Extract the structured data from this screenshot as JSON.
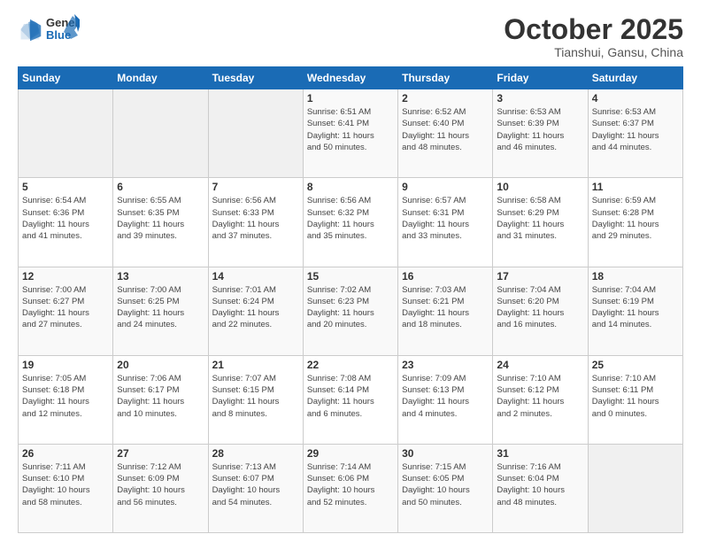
{
  "header": {
    "logo_line1": "General",
    "logo_line2": "Blue",
    "month": "October 2025",
    "location": "Tianshui, Gansu, China"
  },
  "days_of_week": [
    "Sunday",
    "Monday",
    "Tuesday",
    "Wednesday",
    "Thursday",
    "Friday",
    "Saturday"
  ],
  "weeks": [
    [
      {
        "day": "",
        "info": ""
      },
      {
        "day": "",
        "info": ""
      },
      {
        "day": "",
        "info": ""
      },
      {
        "day": "1",
        "info": "Sunrise: 6:51 AM\nSunset: 6:41 PM\nDaylight: 11 hours\nand 50 minutes."
      },
      {
        "day": "2",
        "info": "Sunrise: 6:52 AM\nSunset: 6:40 PM\nDaylight: 11 hours\nand 48 minutes."
      },
      {
        "day": "3",
        "info": "Sunrise: 6:53 AM\nSunset: 6:39 PM\nDaylight: 11 hours\nand 46 minutes."
      },
      {
        "day": "4",
        "info": "Sunrise: 6:53 AM\nSunset: 6:37 PM\nDaylight: 11 hours\nand 44 minutes."
      }
    ],
    [
      {
        "day": "5",
        "info": "Sunrise: 6:54 AM\nSunset: 6:36 PM\nDaylight: 11 hours\nand 41 minutes."
      },
      {
        "day": "6",
        "info": "Sunrise: 6:55 AM\nSunset: 6:35 PM\nDaylight: 11 hours\nand 39 minutes."
      },
      {
        "day": "7",
        "info": "Sunrise: 6:56 AM\nSunset: 6:33 PM\nDaylight: 11 hours\nand 37 minutes."
      },
      {
        "day": "8",
        "info": "Sunrise: 6:56 AM\nSunset: 6:32 PM\nDaylight: 11 hours\nand 35 minutes."
      },
      {
        "day": "9",
        "info": "Sunrise: 6:57 AM\nSunset: 6:31 PM\nDaylight: 11 hours\nand 33 minutes."
      },
      {
        "day": "10",
        "info": "Sunrise: 6:58 AM\nSunset: 6:29 PM\nDaylight: 11 hours\nand 31 minutes."
      },
      {
        "day": "11",
        "info": "Sunrise: 6:59 AM\nSunset: 6:28 PM\nDaylight: 11 hours\nand 29 minutes."
      }
    ],
    [
      {
        "day": "12",
        "info": "Sunrise: 7:00 AM\nSunset: 6:27 PM\nDaylight: 11 hours\nand 27 minutes."
      },
      {
        "day": "13",
        "info": "Sunrise: 7:00 AM\nSunset: 6:25 PM\nDaylight: 11 hours\nand 24 minutes."
      },
      {
        "day": "14",
        "info": "Sunrise: 7:01 AM\nSunset: 6:24 PM\nDaylight: 11 hours\nand 22 minutes."
      },
      {
        "day": "15",
        "info": "Sunrise: 7:02 AM\nSunset: 6:23 PM\nDaylight: 11 hours\nand 20 minutes."
      },
      {
        "day": "16",
        "info": "Sunrise: 7:03 AM\nSunset: 6:21 PM\nDaylight: 11 hours\nand 18 minutes."
      },
      {
        "day": "17",
        "info": "Sunrise: 7:04 AM\nSunset: 6:20 PM\nDaylight: 11 hours\nand 16 minutes."
      },
      {
        "day": "18",
        "info": "Sunrise: 7:04 AM\nSunset: 6:19 PM\nDaylight: 11 hours\nand 14 minutes."
      }
    ],
    [
      {
        "day": "19",
        "info": "Sunrise: 7:05 AM\nSunset: 6:18 PM\nDaylight: 11 hours\nand 12 minutes."
      },
      {
        "day": "20",
        "info": "Sunrise: 7:06 AM\nSunset: 6:17 PM\nDaylight: 11 hours\nand 10 minutes."
      },
      {
        "day": "21",
        "info": "Sunrise: 7:07 AM\nSunset: 6:15 PM\nDaylight: 11 hours\nand 8 minutes."
      },
      {
        "day": "22",
        "info": "Sunrise: 7:08 AM\nSunset: 6:14 PM\nDaylight: 11 hours\nand 6 minutes."
      },
      {
        "day": "23",
        "info": "Sunrise: 7:09 AM\nSunset: 6:13 PM\nDaylight: 11 hours\nand 4 minutes."
      },
      {
        "day": "24",
        "info": "Sunrise: 7:10 AM\nSunset: 6:12 PM\nDaylight: 11 hours\nand 2 minutes."
      },
      {
        "day": "25",
        "info": "Sunrise: 7:10 AM\nSunset: 6:11 PM\nDaylight: 11 hours\nand 0 minutes."
      }
    ],
    [
      {
        "day": "26",
        "info": "Sunrise: 7:11 AM\nSunset: 6:10 PM\nDaylight: 10 hours\nand 58 minutes."
      },
      {
        "day": "27",
        "info": "Sunrise: 7:12 AM\nSunset: 6:09 PM\nDaylight: 10 hours\nand 56 minutes."
      },
      {
        "day": "28",
        "info": "Sunrise: 7:13 AM\nSunset: 6:07 PM\nDaylight: 10 hours\nand 54 minutes."
      },
      {
        "day": "29",
        "info": "Sunrise: 7:14 AM\nSunset: 6:06 PM\nDaylight: 10 hours\nand 52 minutes."
      },
      {
        "day": "30",
        "info": "Sunrise: 7:15 AM\nSunset: 6:05 PM\nDaylight: 10 hours\nand 50 minutes."
      },
      {
        "day": "31",
        "info": "Sunrise: 7:16 AM\nSunset: 6:04 PM\nDaylight: 10 hours\nand 48 minutes."
      },
      {
        "day": "",
        "info": ""
      }
    ]
  ]
}
